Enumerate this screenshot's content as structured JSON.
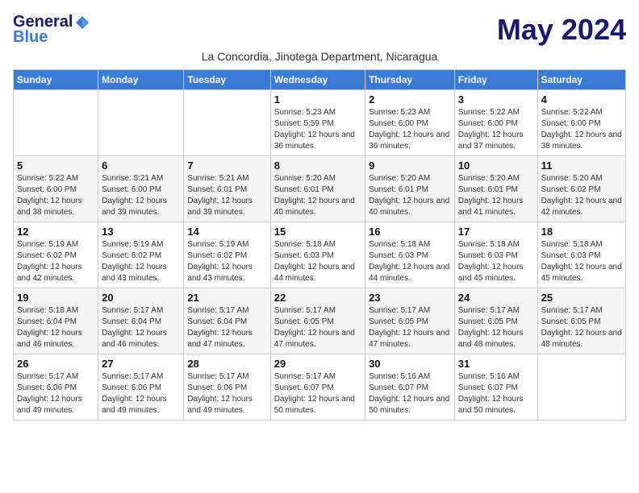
{
  "header": {
    "logo_general": "General",
    "logo_blue": "Blue",
    "month_title": "May 2024",
    "location": "La Concordia, Jinotega Department, Nicaragua"
  },
  "weekdays": [
    "Sunday",
    "Monday",
    "Tuesday",
    "Wednesday",
    "Thursday",
    "Friday",
    "Saturday"
  ],
  "weeks": [
    [
      {
        "day": "",
        "sunrise": "",
        "sunset": "",
        "daylight": ""
      },
      {
        "day": "",
        "sunrise": "",
        "sunset": "",
        "daylight": ""
      },
      {
        "day": "",
        "sunrise": "",
        "sunset": "",
        "daylight": ""
      },
      {
        "day": "1",
        "sunrise": "Sunrise: 5:23 AM",
        "sunset": "Sunset: 5:59 PM",
        "daylight": "Daylight: 12 hours and 36 minutes."
      },
      {
        "day": "2",
        "sunrise": "Sunrise: 5:23 AM",
        "sunset": "Sunset: 6:00 PM",
        "daylight": "Daylight: 12 hours and 36 minutes."
      },
      {
        "day": "3",
        "sunrise": "Sunrise: 5:22 AM",
        "sunset": "Sunset: 6:00 PM",
        "daylight": "Daylight: 12 hours and 37 minutes."
      },
      {
        "day": "4",
        "sunrise": "Sunrise: 5:22 AM",
        "sunset": "Sunset: 6:00 PM",
        "daylight": "Daylight: 12 hours and 38 minutes."
      }
    ],
    [
      {
        "day": "5",
        "sunrise": "Sunrise: 5:22 AM",
        "sunset": "Sunset: 6:00 PM",
        "daylight": "Daylight: 12 hours and 38 minutes."
      },
      {
        "day": "6",
        "sunrise": "Sunrise: 5:21 AM",
        "sunset": "Sunset: 6:00 PM",
        "daylight": "Daylight: 12 hours and 39 minutes."
      },
      {
        "day": "7",
        "sunrise": "Sunrise: 5:21 AM",
        "sunset": "Sunset: 6:01 PM",
        "daylight": "Daylight: 12 hours and 39 minutes."
      },
      {
        "day": "8",
        "sunrise": "Sunrise: 5:20 AM",
        "sunset": "Sunset: 6:01 PM",
        "daylight": "Daylight: 12 hours and 40 minutes."
      },
      {
        "day": "9",
        "sunrise": "Sunrise: 5:20 AM",
        "sunset": "Sunset: 6:01 PM",
        "daylight": "Daylight: 12 hours and 40 minutes."
      },
      {
        "day": "10",
        "sunrise": "Sunrise: 5:20 AM",
        "sunset": "Sunset: 6:01 PM",
        "daylight": "Daylight: 12 hours and 41 minutes."
      },
      {
        "day": "11",
        "sunrise": "Sunrise: 5:20 AM",
        "sunset": "Sunset: 6:02 PM",
        "daylight": "Daylight: 12 hours and 42 minutes."
      }
    ],
    [
      {
        "day": "12",
        "sunrise": "Sunrise: 5:19 AM",
        "sunset": "Sunset: 6:02 PM",
        "daylight": "Daylight: 12 hours and 42 minutes."
      },
      {
        "day": "13",
        "sunrise": "Sunrise: 5:19 AM",
        "sunset": "Sunset: 6:02 PM",
        "daylight": "Daylight: 12 hours and 43 minutes."
      },
      {
        "day": "14",
        "sunrise": "Sunrise: 5:19 AM",
        "sunset": "Sunset: 6:02 PM",
        "daylight": "Daylight: 12 hours and 43 minutes."
      },
      {
        "day": "15",
        "sunrise": "Sunrise: 5:18 AM",
        "sunset": "Sunset: 6:03 PM",
        "daylight": "Daylight: 12 hours and 44 minutes."
      },
      {
        "day": "16",
        "sunrise": "Sunrise: 5:18 AM",
        "sunset": "Sunset: 6:03 PM",
        "daylight": "Daylight: 12 hours and 44 minutes."
      },
      {
        "day": "17",
        "sunrise": "Sunrise: 5:18 AM",
        "sunset": "Sunset: 6:03 PM",
        "daylight": "Daylight: 12 hours and 45 minutes."
      },
      {
        "day": "18",
        "sunrise": "Sunrise: 5:18 AM",
        "sunset": "Sunset: 6:03 PM",
        "daylight": "Daylight: 12 hours and 45 minutes."
      }
    ],
    [
      {
        "day": "19",
        "sunrise": "Sunrise: 5:18 AM",
        "sunset": "Sunset: 6:04 PM",
        "daylight": "Daylight: 12 hours and 46 minutes."
      },
      {
        "day": "20",
        "sunrise": "Sunrise: 5:17 AM",
        "sunset": "Sunset: 6:04 PM",
        "daylight": "Daylight: 12 hours and 46 minutes."
      },
      {
        "day": "21",
        "sunrise": "Sunrise: 5:17 AM",
        "sunset": "Sunset: 6:04 PM",
        "daylight": "Daylight: 12 hours and 47 minutes."
      },
      {
        "day": "22",
        "sunrise": "Sunrise: 5:17 AM",
        "sunset": "Sunset: 6:05 PM",
        "daylight": "Daylight: 12 hours and 47 minutes."
      },
      {
        "day": "23",
        "sunrise": "Sunrise: 5:17 AM",
        "sunset": "Sunset: 6:05 PM",
        "daylight": "Daylight: 12 hours and 47 minutes."
      },
      {
        "day": "24",
        "sunrise": "Sunrise: 5:17 AM",
        "sunset": "Sunset: 6:05 PM",
        "daylight": "Daylight: 12 hours and 48 minutes."
      },
      {
        "day": "25",
        "sunrise": "Sunrise: 5:17 AM",
        "sunset": "Sunset: 6:05 PM",
        "daylight": "Daylight: 12 hours and 48 minutes."
      }
    ],
    [
      {
        "day": "26",
        "sunrise": "Sunrise: 5:17 AM",
        "sunset": "Sunset: 6:06 PM",
        "daylight": "Daylight: 12 hours and 49 minutes."
      },
      {
        "day": "27",
        "sunrise": "Sunrise: 5:17 AM",
        "sunset": "Sunset: 6:06 PM",
        "daylight": "Daylight: 12 hours and 49 minutes."
      },
      {
        "day": "28",
        "sunrise": "Sunrise: 5:17 AM",
        "sunset": "Sunset: 6:06 PM",
        "daylight": "Daylight: 12 hours and 49 minutes."
      },
      {
        "day": "29",
        "sunrise": "Sunrise: 5:17 AM",
        "sunset": "Sunset: 6:07 PM",
        "daylight": "Daylight: 12 hours and 50 minutes."
      },
      {
        "day": "30",
        "sunrise": "Sunrise: 5:16 AM",
        "sunset": "Sunset: 6:07 PM",
        "daylight": "Daylight: 12 hours and 50 minutes."
      },
      {
        "day": "31",
        "sunrise": "Sunrise: 5:16 AM",
        "sunset": "Sunset: 6:07 PM",
        "daylight": "Daylight: 12 hours and 50 minutes."
      },
      {
        "day": "",
        "sunrise": "",
        "sunset": "",
        "daylight": ""
      }
    ]
  ]
}
